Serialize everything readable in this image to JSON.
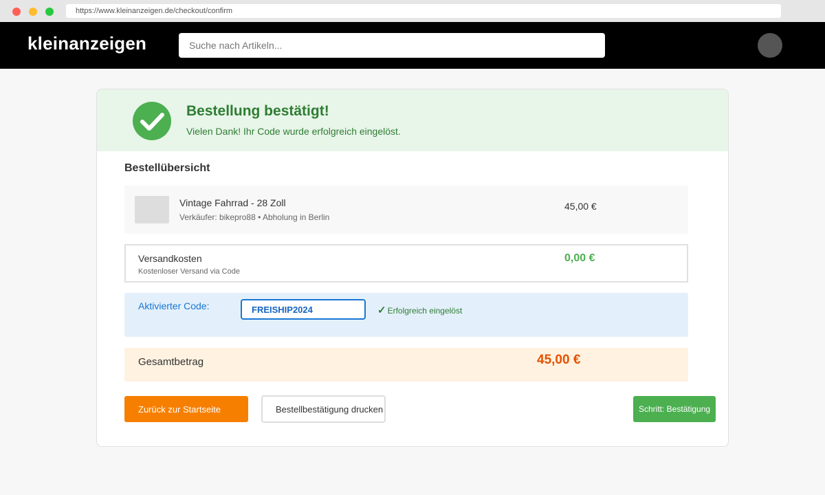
{
  "browser": {
    "url": "https://www.kleinanzeigen.de/checkout/confirm"
  },
  "header": {
    "logo": "kleinanzeigen",
    "search_placeholder": "Suche nach Artikeln...",
    "avatar_icon": "user-avatar-icon"
  },
  "confirmation": {
    "icon": "check-circle-icon",
    "title": "Bestellung bestätigt!",
    "subtitle": "Vielen Dank! Ihr Code wurde erfolgreich eingelöst."
  },
  "summary": {
    "title": "Bestellübersicht",
    "item": {
      "title": "Vintage Fahrrad - 28 Zoll",
      "subtitle": "Verkäufer: bikepro88 • Abholung in Berlin",
      "price": "45,00 €"
    },
    "shipping": {
      "label": "Versandkosten",
      "subtitle": "Kostenloser Versand via Code",
      "price": "0,00 €"
    },
    "code": {
      "label": "Aktivierter Code:",
      "value": "FREISHIP2024",
      "status_icon": "✓",
      "status": "Erfolgreich eingelöst"
    },
    "total": {
      "label": "Gesamtbetrag",
      "value": "45,00 €"
    }
  },
  "actions": {
    "home_label": "Zurück zur Startseite",
    "print_label": "Bestellbestätigung drucken",
    "step_label": "Schritt: Bestätigung"
  },
  "colors": {
    "brand_header": "#000000",
    "success": "#4caf50",
    "success_dark": "#2e7d32",
    "accent_orange": "#f77f00",
    "total_orange": "#e65100",
    "code_blue": "#1976d2"
  }
}
